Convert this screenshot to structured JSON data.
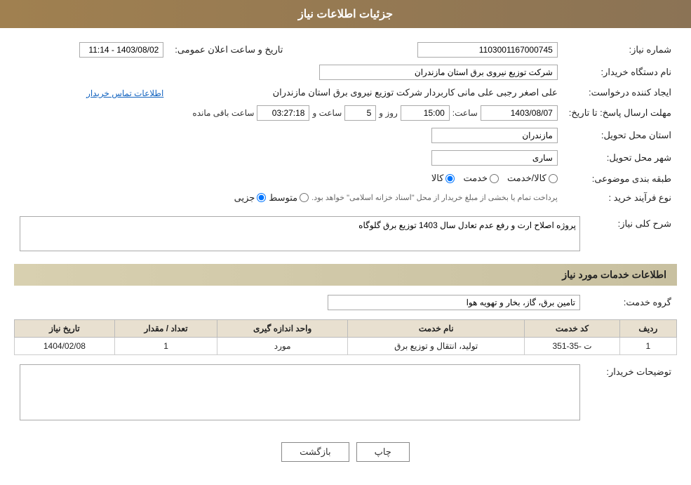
{
  "header": {
    "title": "جزئیات اطلاعات نیاز"
  },
  "fields": {
    "need_number_label": "شماره نیاز:",
    "need_number_value": "1103001167000745",
    "announce_datetime_label": "تاریخ و ساعت اعلان عمومی:",
    "announce_datetime_value": "1403/08/02 - 11:14",
    "buyer_org_label": "نام دستگاه خریدار:",
    "buyer_org_value": "شرکت توزیع نیروی برق استان مازندران",
    "requester_label": "ایجاد کننده درخواست:",
    "requester_value": "علی اصغر رجبی علی مانی کاربردار شرکت توزیع نیروی برق استان مازندران",
    "contact_link": "اطلاعات تماس خریدار",
    "send_deadline_label": "مهلت ارسال پاسخ: تا تاریخ:",
    "send_date_value": "1403/08/07",
    "send_time_label": "ساعت:",
    "send_time_value": "15:00",
    "send_days_label": "روز و",
    "send_days_value": "5",
    "send_remaining_label": "ساعت باقی مانده",
    "send_remaining_value": "03:27:18",
    "province_label": "استان محل تحویل:",
    "province_value": "مازندران",
    "city_label": "شهر محل تحویل:",
    "city_value": "ساری",
    "category_label": "طبقه بندی موضوعی:",
    "category_radio_kala": "کالا",
    "category_radio_khedmat": "خدمت",
    "category_radio_kala_khedmat": "کالا/خدمت",
    "purchase_type_label": "نوع فرآیند خرید :",
    "purchase_jozii": "جزیی",
    "purchase_motavaset": "متوسط",
    "purchase_note": "پرداخت تمام یا بخشی از مبلغ خریدار از محل \"اسناد خزانه اسلامی\" خواهد بود.",
    "need_desc_label": "شرح کلی نیاز:",
    "need_desc_value": "پروژه اصلاح ارت و رفع عدم تعادل سال 1403 توزیع برق گلوگاه",
    "services_section_label": "اطلاعات خدمات مورد نیاز",
    "service_group_label": "گروه خدمت:",
    "service_group_value": "تامین برق، گاز، بخار و تهویه هوا",
    "table": {
      "headers": [
        "ردیف",
        "کد خدمت",
        "نام خدمت",
        "واحد اندازه گیری",
        "تعداد / مقدار",
        "تاریخ نیاز"
      ],
      "rows": [
        {
          "row": "1",
          "code": "ت -35-351",
          "name": "تولید، انتقال و توزیع برق",
          "unit": "مورد",
          "qty": "1",
          "date": "1404/02/08"
        }
      ]
    },
    "buyer_desc_label": "توضیحات خریدار:",
    "buyer_desc_value": ""
  },
  "buttons": {
    "print": "چاپ",
    "back": "بازگشت"
  }
}
